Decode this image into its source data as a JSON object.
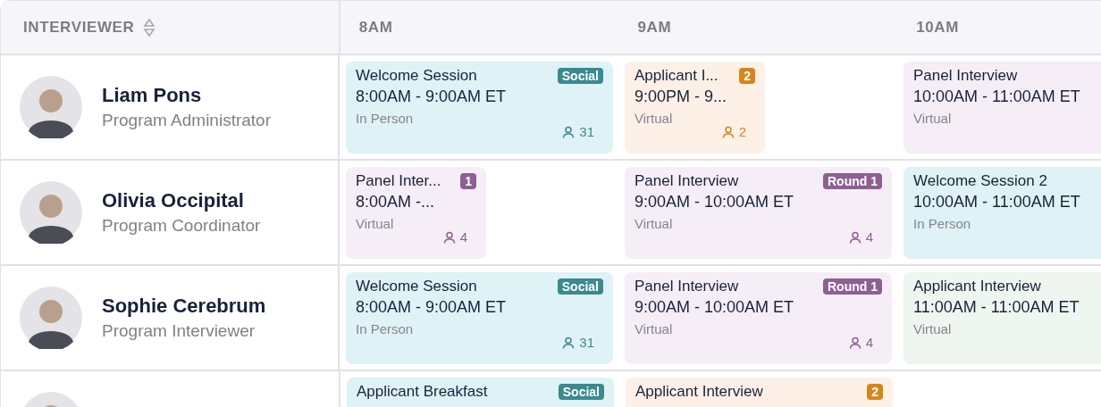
{
  "header": {
    "interviewer_label": "INTERVIEWER",
    "hours": [
      "8AM",
      "9AM",
      "10AM"
    ]
  },
  "rows": [
    {
      "name": "Liam Pons",
      "role": "Program Administrator",
      "slots": [
        [
          {
            "kind": "social",
            "title": "Welcome Session",
            "time": "8:00AM - 9:00AM ET",
            "location": "In Person",
            "badge": "Social",
            "count": "31",
            "compact": false
          }
        ],
        [
          {
            "kind": "applicant",
            "title": "Applicant I...",
            "time": "9:00PM - 9...",
            "location": "Virtual",
            "badge": "2",
            "count": "2",
            "compact": true
          }
        ],
        [
          {
            "kind": "panel",
            "title": "Panel Interview",
            "time": "10:00AM - 11:00AM ET",
            "location": "Virtual",
            "compact": false
          }
        ]
      ]
    },
    {
      "name": "Olivia Occipital",
      "role": "Program Coordinator",
      "slots": [
        [
          {
            "kind": "panel",
            "title": "Panel Inter...",
            "time": "8:00AM -...",
            "location": "Virtual",
            "badge": "1",
            "count": "4",
            "compact": true
          }
        ],
        [
          {
            "kind": "panel",
            "title": "Panel Interview",
            "time": "9:00AM - 10:00AM ET",
            "location": "Virtual",
            "badge": "Round 1",
            "count": "4",
            "compact": false
          }
        ],
        [
          {
            "kind": "social",
            "title": "Welcome Session 2",
            "time": "10:00AM - 11:00AM ET",
            "location": "In Person",
            "compact": false
          }
        ]
      ]
    },
    {
      "name": "Sophie Cerebrum",
      "role": "Program Interviewer",
      "slots": [
        [
          {
            "kind": "social",
            "title": "Welcome Session",
            "time": "8:00AM - 9:00AM ET",
            "location": "In Person",
            "badge": "Social",
            "count": "31",
            "compact": false
          }
        ],
        [
          {
            "kind": "panel",
            "title": "Panel Interview",
            "time": "9:00AM - 10:00AM ET",
            "location": "Virtual",
            "badge": "Round 1",
            "count": "4",
            "compact": false
          }
        ],
        [
          {
            "kind": "interview",
            "title": "Applicant Interview",
            "time": "11:00AM - 11:00AM ET",
            "location": "Virtual",
            "compact": false
          }
        ]
      ]
    },
    {
      "slots": [
        [
          {
            "kind": "social",
            "title": "Applicant Breakfast",
            "badge": "Social",
            "compact": false
          }
        ],
        [
          {
            "kind": "applicant",
            "title": "Applicant Interview",
            "badge": "2",
            "compact": false
          }
        ]
      ]
    }
  ]
}
